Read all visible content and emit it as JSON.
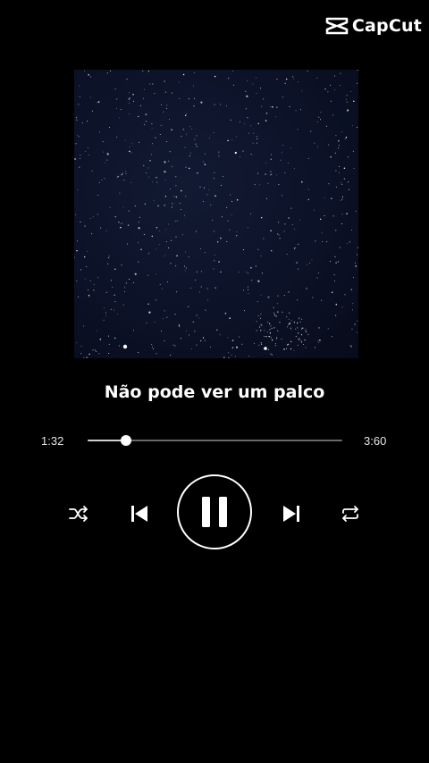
{
  "watermark": {
    "brand": "CapCut",
    "icon": "capcut-logo-icon"
  },
  "cover": {
    "description_icon": "starry-night-sky"
  },
  "track": {
    "title": "Não pode ver um palco"
  },
  "progress": {
    "elapsed": "1:32",
    "total": "3:60",
    "fraction": 0.15
  },
  "controls": {
    "shuffle_icon": "shuffle-icon",
    "previous_icon": "skip-previous-icon",
    "play_state_icon": "pause-icon",
    "next_icon": "skip-next-icon",
    "repeat_icon": "repeat-icon"
  },
  "colors": {
    "background": "#000000",
    "foreground": "#ffffff",
    "track_inactive": "#6a6a6a",
    "cover_sky": "#0c1228"
  }
}
